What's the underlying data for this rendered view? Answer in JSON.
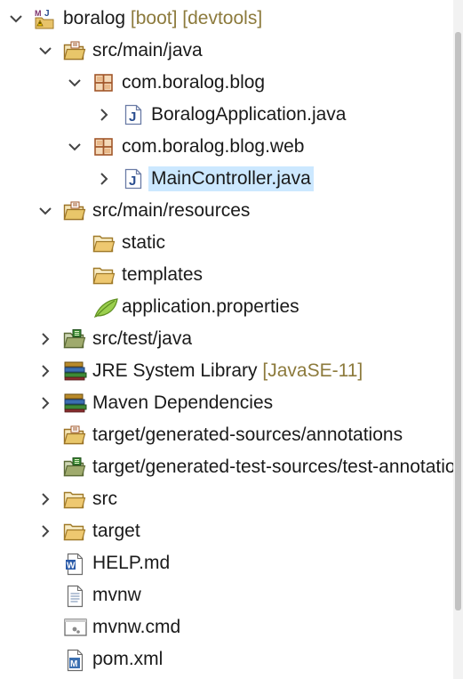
{
  "colors": {
    "selection": "#cce8ff",
    "decoration": "#8c7a3c",
    "folder": "#d8a84a",
    "package": "#a2572a",
    "java_file": "#2a4d8f"
  },
  "tree": [
    {
      "id": "boralog",
      "label": "boralog",
      "decoration": "[boot] [devtools]",
      "icon": "maven-java-project-icon",
      "expanded": true,
      "depth": 0
    },
    {
      "id": "src-main-java",
      "label": "src/main/java",
      "icon": "source-folder-icon",
      "expanded": true,
      "depth": 1
    },
    {
      "id": "pkg-blog",
      "label": "com.boralog.blog",
      "icon": "package-icon",
      "expanded": true,
      "depth": 2
    },
    {
      "id": "boralog-application",
      "label": "BoralogApplication.java",
      "icon": "java-file-icon",
      "expanded": false,
      "depth": 3
    },
    {
      "id": "pkg-blog-web",
      "label": "com.boralog.blog.web",
      "icon": "package-icon",
      "expanded": true,
      "depth": 2
    },
    {
      "id": "main-controller",
      "label": "MainController.java",
      "icon": "java-file-icon",
      "expanded": false,
      "depth": 3,
      "selected": true
    },
    {
      "id": "src-main-resources",
      "label": "src/main/resources",
      "icon": "source-folder-icon",
      "expanded": true,
      "depth": 1
    },
    {
      "id": "static",
      "label": "static",
      "icon": "folder-icon",
      "depth": 2
    },
    {
      "id": "templates",
      "label": "templates",
      "icon": "folder-icon",
      "depth": 2
    },
    {
      "id": "application-properties",
      "label": "application.properties",
      "icon": "properties-leaf-icon",
      "depth": 2
    },
    {
      "id": "src-test-java",
      "label": "src/test/java",
      "icon": "test-source-folder-icon",
      "expanded": false,
      "depth": 1
    },
    {
      "id": "jre-library",
      "label": "JRE System Library",
      "decoration": "[JavaSE-11]",
      "icon": "library-icon",
      "expanded": false,
      "depth": 1
    },
    {
      "id": "maven-deps",
      "label": "Maven Dependencies",
      "icon": "library-icon",
      "expanded": false,
      "depth": 1
    },
    {
      "id": "target-gen-annotations",
      "label": "target/generated-sources/annotations",
      "icon": "source-folder-icon",
      "depth": 1
    },
    {
      "id": "target-gen-test",
      "label": "target/generated-test-sources/test-annotations",
      "icon": "test-source-folder-icon",
      "depth": 1
    },
    {
      "id": "src",
      "label": "src",
      "icon": "folder-icon",
      "expanded": false,
      "depth": 1
    },
    {
      "id": "target",
      "label": "target",
      "icon": "folder-icon",
      "expanded": false,
      "depth": 1
    },
    {
      "id": "help-md",
      "label": "HELP.md",
      "icon": "word-document-icon",
      "depth": 1
    },
    {
      "id": "mvnw",
      "label": "mvnw",
      "icon": "text-file-icon",
      "depth": 1
    },
    {
      "id": "mvnw-cmd",
      "label": "mvnw.cmd",
      "icon": "cmd-file-icon",
      "depth": 1
    },
    {
      "id": "pom-xml",
      "label": "pom.xml",
      "icon": "maven-pom-icon",
      "depth": 1
    }
  ]
}
